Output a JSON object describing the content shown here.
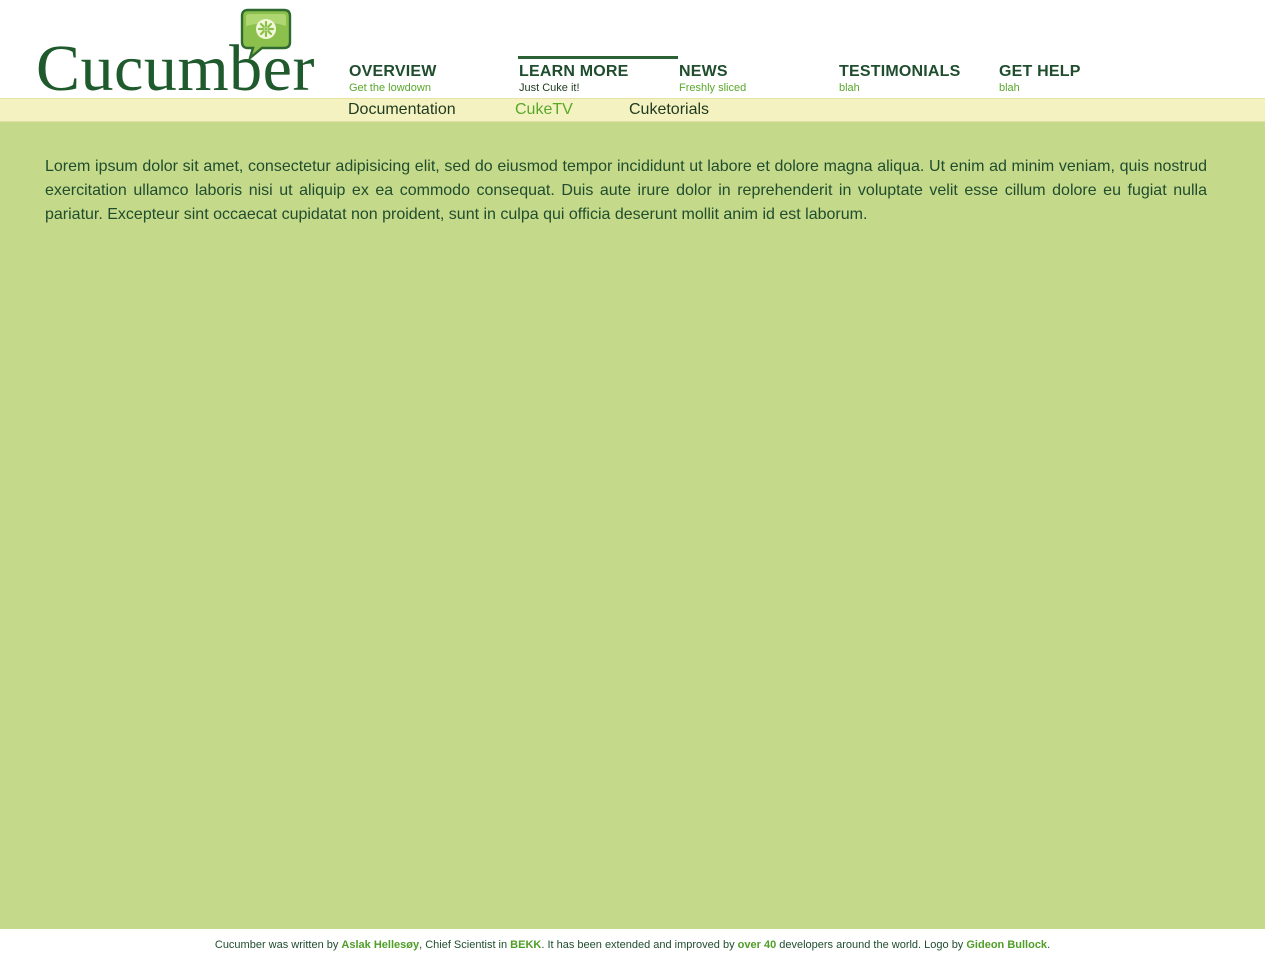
{
  "brand": {
    "name": "Cucumber",
    "logo_icon": "cucumber-slice-speech-bubble-icon",
    "color_dark": "#1f5a2d",
    "color_light": "#8fc34a"
  },
  "nav": {
    "items": [
      {
        "title": "OVERVIEW",
        "subtitle": "Get the lowdown"
      },
      {
        "title": "LEARN MORE",
        "subtitle": "Just Cuke it!"
      },
      {
        "title": "NEWS",
        "subtitle": "Freshly sliced"
      },
      {
        "title": "TESTIMONIALS",
        "subtitle": "blah"
      },
      {
        "title": "GET HELP",
        "subtitle": "blah"
      }
    ],
    "active_index": 1
  },
  "subnav": {
    "items": [
      "Documentation",
      "CukeTV",
      "Cuketorials"
    ],
    "current_index": 1
  },
  "content": {
    "intro": "Lorem ipsum dolor sit amet, consectetur adipisicing elit, sed do eiusmod tempor incididunt ut labore et dolore magna aliqua. Ut enim ad minim veniam, quis nostrud exercitation ullamco laboris nisi ut aliquip ex ea commodo consequat. Duis aute irure dolor in reprehenderit in voluptate velit esse cillum dolore eu fugiat nulla pariatur. Excepteur sint occaecat cupidatat non proident, sunt in culpa qui officia deserunt mollit anim id est laborum."
  },
  "footer": {
    "text1": "Cucumber was written by ",
    "author": "Aslak Hellesøy",
    "text2": ", Chief Scientist in ",
    "company": "BEKK",
    "text3": ". It has been extended and improved by ",
    "contributors": "over 40",
    "text4": " developers around the world. Logo by ",
    "logo_author": "Gideon Bullock",
    "text5": "."
  },
  "colors": {
    "content_bg": "#c5d98a",
    "subnav_bg": "#f5f2c2",
    "accent_green": "#58a82a",
    "text_dark": "#1f4d2e"
  }
}
